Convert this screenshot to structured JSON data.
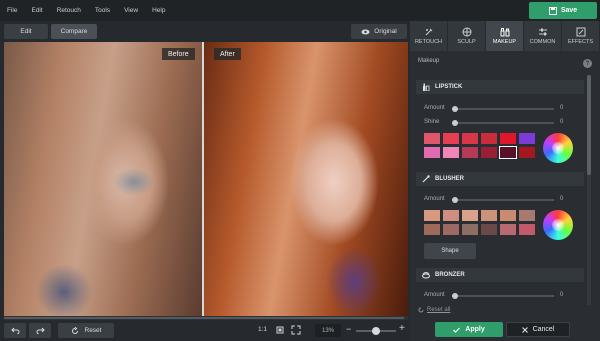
{
  "menu": [
    "File",
    "Edit",
    "Retouch",
    "Tools",
    "View",
    "Help"
  ],
  "save_label": "Save",
  "toolbar": {
    "edit": "Edit",
    "compare": "Compare",
    "original": "Original"
  },
  "canvas": {
    "before": "Before",
    "after": "After"
  },
  "bottom": {
    "reset": "Reset",
    "zoom_fit": "1:1",
    "zoom_percent": "13%"
  },
  "tabs": [
    {
      "label": "RETOUCH",
      "icon": "retouch-icon"
    },
    {
      "label": "SCULP",
      "icon": "sculpt-icon"
    },
    {
      "label": "MAKEUP",
      "icon": "makeup-icon",
      "active": true
    },
    {
      "label": "COMMON",
      "icon": "sliders-icon"
    },
    {
      "label": "EFFECTS",
      "icon": "effects-icon"
    }
  ],
  "panel": {
    "title": "Makeup",
    "lipstick": {
      "title": "LIPSTICK",
      "amount_label": "Amount",
      "amount_value": "0",
      "shine_label": "Shine",
      "shine_value": "0",
      "swatches": [
        "#e0566a",
        "#e83e52",
        "#d9364a",
        "#c92d3c",
        "#e0172c",
        "#7a3bd6",
        "#e26ab0",
        "#f085b6",
        "#b43a56",
        "#9a1f36",
        "#5a1028",
        "#a3191f"
      ]
    },
    "blusher": {
      "title": "BLUSHER",
      "amount_label": "Amount",
      "amount_value": "0",
      "shape_label": "Shape",
      "swatches": [
        "#d79a7e",
        "#cf8e80",
        "#d9a28a",
        "#cc927a",
        "#c98b72",
        "#a77a6e",
        "#a06a5a",
        "#9c6a62",
        "#8e6e62",
        "#6a4a48",
        "#b86a70",
        "#c25a6a"
      ]
    },
    "bronzer": {
      "title": "BRONZER",
      "amount_label": "Amount",
      "amount_value": "0"
    },
    "reset_all": "Reset all"
  },
  "apply_label": "Apply",
  "cancel_label": "Cancel",
  "colors": {
    "accent": "#2f9e6a",
    "panel": "#2a2e32",
    "background": "#262a2e"
  }
}
